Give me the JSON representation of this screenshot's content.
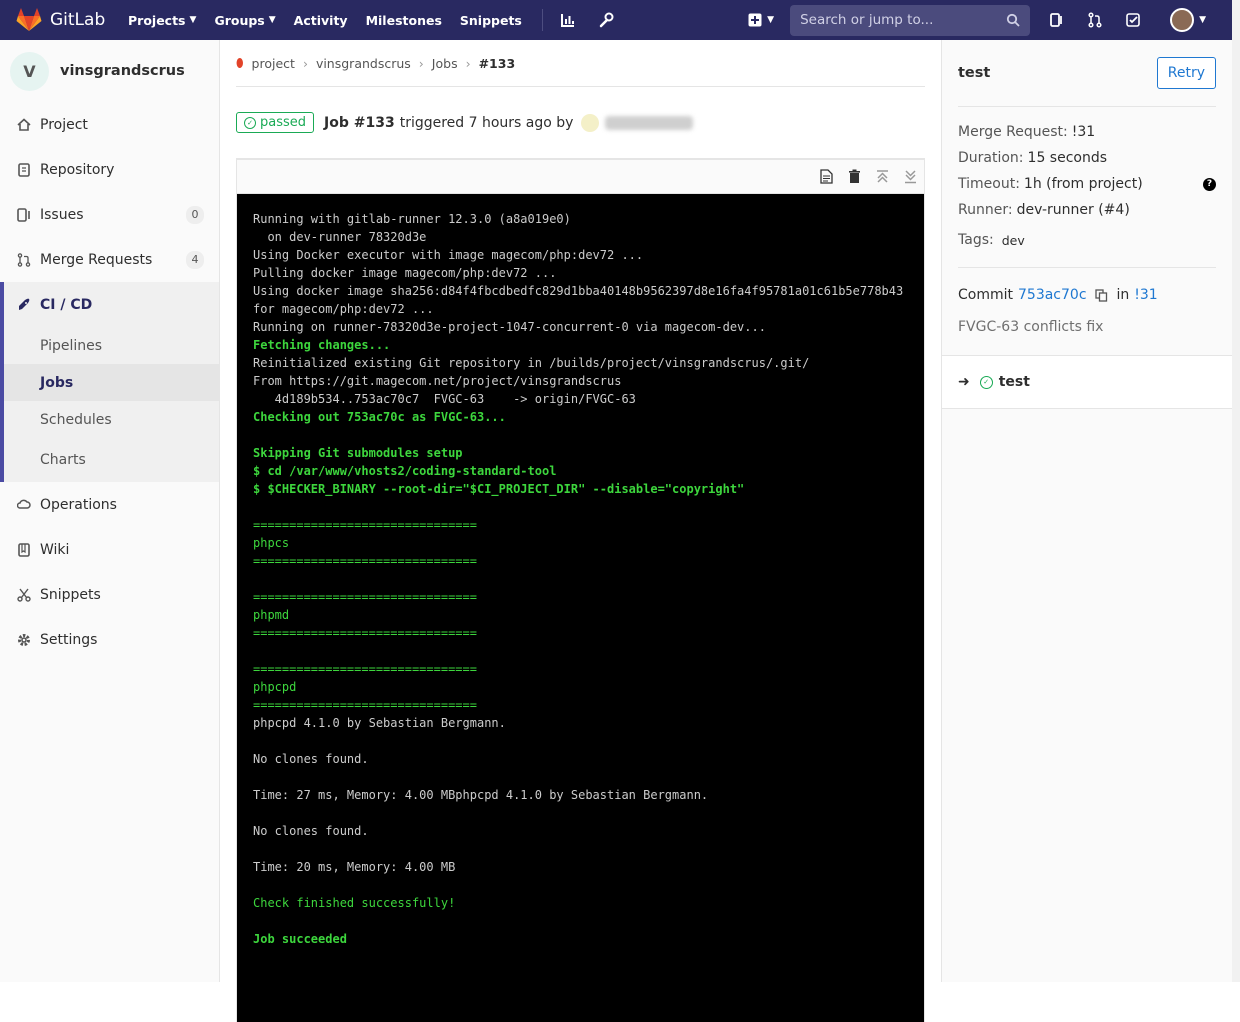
{
  "navbar": {
    "brand": "GitLab",
    "links": [
      {
        "label": "Projects",
        "dropdown": true
      },
      {
        "label": "Groups",
        "dropdown": true
      },
      {
        "label": "Activity",
        "dropdown": false
      },
      {
        "label": "Milestones",
        "dropdown": false
      },
      {
        "label": "Snippets",
        "dropdown": false
      }
    ],
    "search_placeholder": "Search or jump to..."
  },
  "sidebar": {
    "project_initial": "V",
    "project_name": "vinsgrandscrus",
    "items": [
      {
        "label": "Project",
        "icon": "home-icon"
      },
      {
        "label": "Repository",
        "icon": "doc-icon"
      },
      {
        "label": "Issues",
        "icon": "issues-icon",
        "count": "0"
      },
      {
        "label": "Merge Requests",
        "icon": "merge-icon",
        "count": "4"
      }
    ],
    "cicd": {
      "label": "CI / CD",
      "subitems": [
        {
          "label": "Pipelines",
          "active": false
        },
        {
          "label": "Jobs",
          "active": true
        },
        {
          "label": "Schedules",
          "active": false
        },
        {
          "label": "Charts",
          "active": false
        }
      ]
    },
    "items_after": [
      {
        "label": "Operations",
        "icon": "cloud-icon"
      },
      {
        "label": "Wiki",
        "icon": "book-icon"
      },
      {
        "label": "Snippets",
        "icon": "scissors-icon"
      },
      {
        "label": "Settings",
        "icon": "gear-icon"
      }
    ]
  },
  "breadcrumb": {
    "items": [
      "project",
      "vinsgrandscrus",
      "Jobs"
    ],
    "current": "#133"
  },
  "job_header": {
    "status": "passed",
    "job": "Job #133",
    "triggered": "triggered 7 hours ago by"
  },
  "log": [
    {
      "t": "Running with gitlab-runner 12.3.0 (a8a019e0)",
      "s": "n"
    },
    {
      "t": "  on dev-runner 78320d3e",
      "s": "n"
    },
    {
      "t": "Using Docker executor with image magecom/php:dev72 ...",
      "s": "n"
    },
    {
      "t": "Pulling docker image magecom/php:dev72 ...",
      "s": "n"
    },
    {
      "t": "Using docker image sha256:d84f4fbcdbedfc829d1bba40148b9562397d8e16fa4f95781a01c61b5e778b43",
      "s": "n"
    },
    {
      "t": "for magecom/php:dev72 ...",
      "s": "n"
    },
    {
      "t": "Running on runner-78320d3e-project-1047-concurrent-0 via magecom-dev...",
      "s": "n"
    },
    {
      "t": "Fetching changes...",
      "s": "g"
    },
    {
      "t": "Reinitialized existing Git repository in /builds/project/vinsgrandscrus/.git/",
      "s": "n"
    },
    {
      "t": "From https://git.magecom.net/project/vinsgrandscrus",
      "s": "n"
    },
    {
      "t": "   4d189b534..753ac70c7  FVGC-63    -> origin/FVGC-63",
      "s": "n"
    },
    {
      "t": "Checking out 753ac70c as FVGC-63...",
      "s": "g"
    },
    {
      "t": "",
      "s": "n"
    },
    {
      "t": "Skipping Git submodules setup",
      "s": "g"
    },
    {
      "t": "$ cd /var/www/vhosts2/coding-standard-tool",
      "s": "g"
    },
    {
      "t": "$ $CHECKER_BINARY --root-dir=\"$CI_PROJECT_DIR\" --disable=\"copyright\"",
      "s": "g"
    },
    {
      "t": "",
      "s": "n"
    },
    {
      "t": "===============================",
      "s": "gl"
    },
    {
      "t": "phpcs",
      "s": "gl"
    },
    {
      "t": "===============================",
      "s": "gl"
    },
    {
      "t": "",
      "s": "n"
    },
    {
      "t": "===============================",
      "s": "gl"
    },
    {
      "t": "phpmd",
      "s": "gl"
    },
    {
      "t": "===============================",
      "s": "gl"
    },
    {
      "t": "",
      "s": "n"
    },
    {
      "t": "===============================",
      "s": "gl"
    },
    {
      "t": "phpcpd",
      "s": "gl"
    },
    {
      "t": "===============================",
      "s": "gl"
    },
    {
      "t": "phpcpd 4.1.0 by Sebastian Bergmann.",
      "s": "n"
    },
    {
      "t": "",
      "s": "n"
    },
    {
      "t": "No clones found.",
      "s": "n"
    },
    {
      "t": "",
      "s": "n"
    },
    {
      "t": "Time: 27 ms, Memory: 4.00 MBphpcpd 4.1.0 by Sebastian Bergmann.",
      "s": "n"
    },
    {
      "t": "",
      "s": "n"
    },
    {
      "t": "No clones found.",
      "s": "n"
    },
    {
      "t": "",
      "s": "n"
    },
    {
      "t": "Time: 20 ms, Memory: 4.00 MB",
      "s": "n"
    },
    {
      "t": "",
      "s": "n"
    },
    {
      "t": "Check finished successfully!",
      "s": "gl"
    },
    {
      "t": "",
      "s": "n"
    },
    {
      "t": "Job succeeded",
      "s": "g"
    }
  ],
  "right_sidebar": {
    "job_name": "test",
    "retry_label": "Retry",
    "merge_request_label": "Merge Request:",
    "merge_request": "!31",
    "duration_label": "Duration:",
    "duration": "15 seconds",
    "timeout_label": "Timeout:",
    "timeout": "1h (from project)",
    "runner_label": "Runner:",
    "runner": "dev-runner (#4)",
    "tags_label": "Tags:",
    "tag": "dev",
    "commit_label": "Commit",
    "commit_sha": "753ac70c",
    "in_label": "in",
    "commit_mr": "!31",
    "commit_title": "FVGC-63 conflicts fix",
    "stage_job": "test"
  },
  "colors": {
    "navbar": "#292961",
    "success": "#1aaa55",
    "link": "#1f78d1",
    "log_green": "#3dd63d"
  }
}
